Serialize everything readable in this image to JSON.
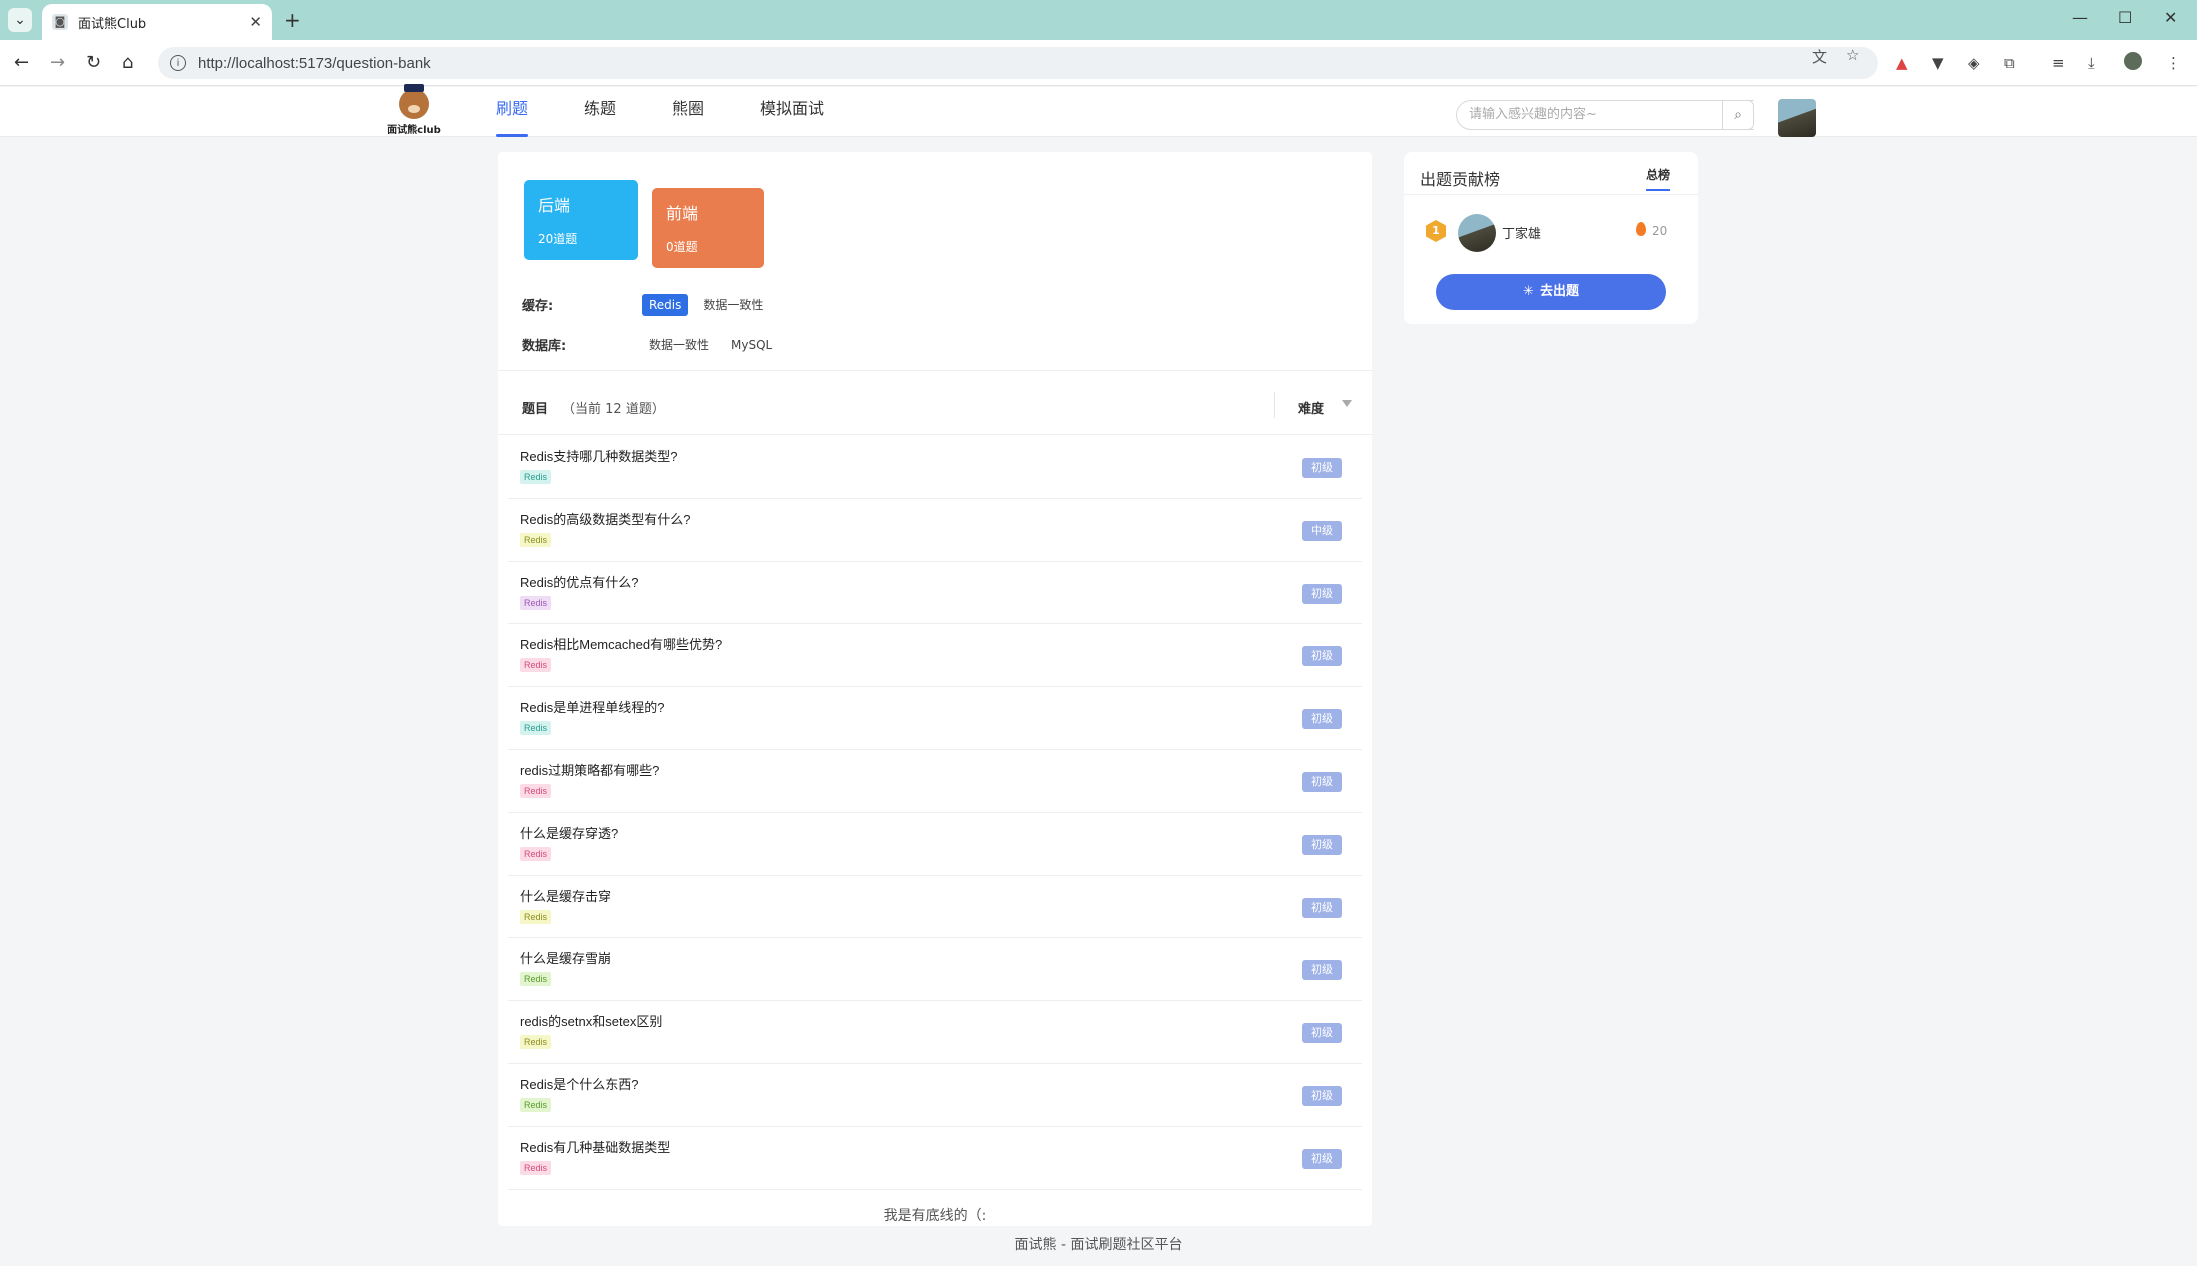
{
  "browser": {
    "tab_title": "面试熊Club",
    "url": "http://localhost:5173/question-bank"
  },
  "site": {
    "logo_text": "面试熊club",
    "nav": [
      {
        "label": "刷题",
        "active": true
      },
      {
        "label": "练题",
        "active": false
      },
      {
        "label": "熊圈",
        "active": false
      },
      {
        "label": "模拟面试",
        "active": false
      }
    ],
    "search_placeholder": "请输入感兴趣的内容~"
  },
  "categories": [
    {
      "name": "后端",
      "count": "20道题",
      "color": "#28b4f2"
    },
    {
      "name": "前端",
      "count": "0道题",
      "color": "#ea7d4d"
    }
  ],
  "filters": [
    {
      "label": "缓存:",
      "chips": [
        {
          "text": "Redis",
          "active": true
        },
        {
          "text": "数据一致性",
          "active": false
        }
      ]
    },
    {
      "label": "数据库:",
      "chips": [
        {
          "text": "数据一致性",
          "active": false
        },
        {
          "text": "MySQL",
          "active": false
        }
      ]
    }
  ],
  "question_header": {
    "title": "题目",
    "count": "（当前 12 道题）",
    "difficulty": "难度"
  },
  "questions": [
    {
      "title": "Redis支持哪几种数据类型?",
      "tag": "Redis",
      "tag_bg": "#d4f3ef",
      "tag_color": "#2a9d8f",
      "level": "初级"
    },
    {
      "title": "Redis的高级数据类型有什么?",
      "tag": "Redis",
      "tag_bg": "#f5f7c6",
      "tag_color": "#8a8f1f",
      "level": "中级"
    },
    {
      "title": "Redis的优点有什么?",
      "tag": "Redis",
      "tag_bg": "#efdcf5",
      "tag_color": "#9b59b6",
      "level": "初级"
    },
    {
      "title": "Redis相比Memcached有哪些优势?",
      "tag": "Redis",
      "tag_bg": "#fbdbe5",
      "tag_color": "#d64c78",
      "level": "初级"
    },
    {
      "title": "Redis是单进程单线程的?",
      "tag": "Redis",
      "tag_bg": "#d4f3ef",
      "tag_color": "#2a9d8f",
      "level": "初级"
    },
    {
      "title": "redis过期策略都有哪些?",
      "tag": "Redis",
      "tag_bg": "#fbdbe5",
      "tag_color": "#d64c78",
      "level": "初级"
    },
    {
      "title": "什么是缓存穿透?",
      "tag": "Redis",
      "tag_bg": "#fbdbe5",
      "tag_color": "#d64c78",
      "level": "初级"
    },
    {
      "title": "什么是缓存击穿",
      "tag": "Redis",
      "tag_bg": "#f5f7c6",
      "tag_color": "#8a8f1f",
      "level": "初级"
    },
    {
      "title": "什么是缓存雪崩",
      "tag": "Redis",
      "tag_bg": "#e3f5cf",
      "tag_color": "#5a9b2a",
      "level": "初级"
    },
    {
      "title": "redis的setnx和setex区别",
      "tag": "Redis",
      "tag_bg": "#f5f7c6",
      "tag_color": "#8a8f1f",
      "level": "初级"
    },
    {
      "title": "Redis是个什么东西?",
      "tag": "Redis",
      "tag_bg": "#e3f5cf",
      "tag_color": "#5a9b2a",
      "level": "初级"
    },
    {
      "title": "Redis有几种基础数据类型",
      "tag": "Redis",
      "tag_bg": "#fbdbe5",
      "tag_color": "#d64c78",
      "level": "初级"
    }
  ],
  "end_text": "我是有底线的（:",
  "footer": "面试熊 - 面试刷题社区平台",
  "ranking": {
    "title": "出题贡献榜",
    "tab": "总榜",
    "entries": [
      {
        "rank": "1",
        "name": "丁家雄",
        "score": "20"
      }
    ],
    "button": "去出题"
  }
}
